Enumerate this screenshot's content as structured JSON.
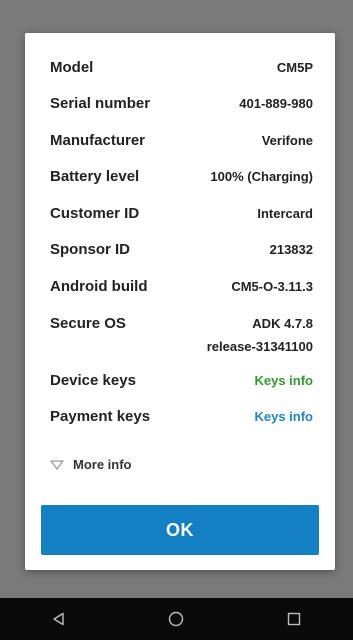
{
  "device_info": {
    "rows": [
      {
        "label": "Model",
        "value": "CM5P"
      },
      {
        "label": "Serial number",
        "value": "401-889-980"
      },
      {
        "label": "Manufacturer",
        "value": "Verifone"
      },
      {
        "label": "Battery level",
        "value": "100% (Charging)"
      },
      {
        "label": "Customer ID",
        "value": "Intercard"
      },
      {
        "label": "Sponsor ID",
        "value": "213832"
      },
      {
        "label": "Android build",
        "value": "CM5-O-3.11.3"
      }
    ],
    "secure_os": {
      "label": "Secure OS",
      "value_line1": "ADK 4.7.8",
      "value_line2": "release-31341100"
    },
    "device_keys": {
      "label": "Device keys",
      "link": "Keys info"
    },
    "payment_keys": {
      "label": "Payment keys",
      "link": "Keys info"
    }
  },
  "more_info": {
    "label": "More info",
    "icon": "triangle-down-icon"
  },
  "ok_button": {
    "label": "OK"
  },
  "navbar": {
    "back_icon": "back-icon",
    "home_icon": "home-icon",
    "recents_icon": "recents-icon"
  },
  "colors": {
    "accent": "#1480c4",
    "link_green": "#2e9a2e",
    "link_blue": "#1f86c8",
    "scrim": "#7a7a7a"
  }
}
